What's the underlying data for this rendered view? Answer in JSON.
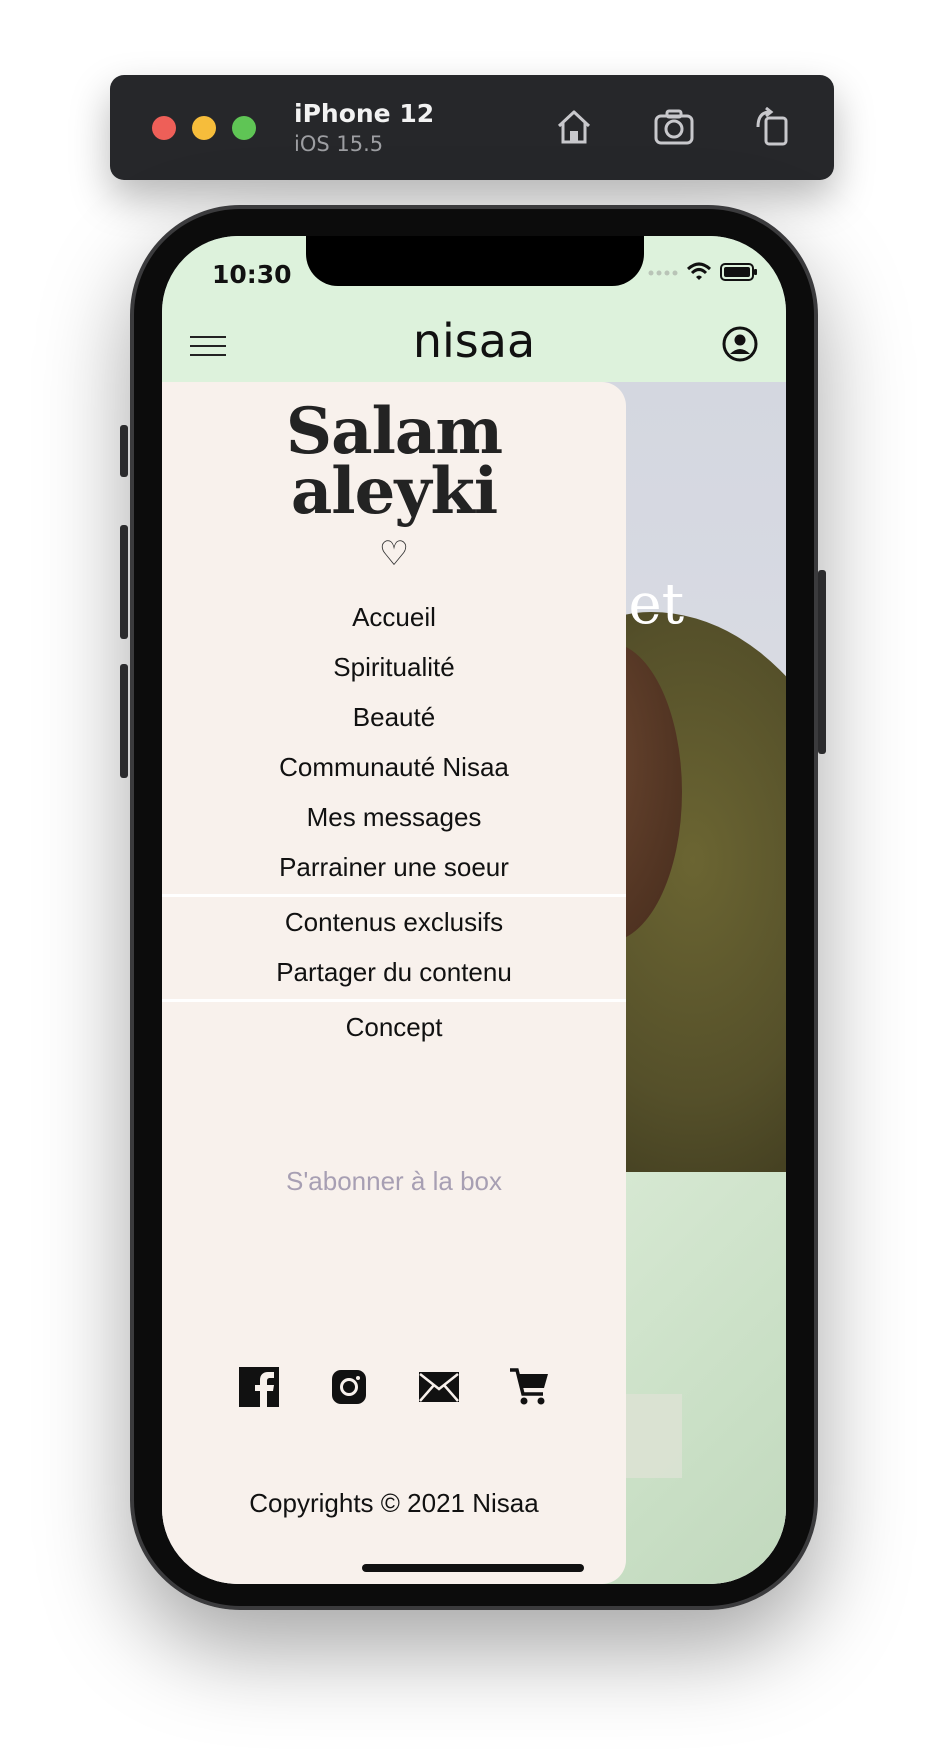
{
  "simulator": {
    "device_name": "iPhone 12",
    "os_version": "iOS 15.5",
    "icons": [
      "home-icon",
      "screenshot-icon",
      "rotate-icon"
    ]
  },
  "status_bar": {
    "time": "10:30",
    "icons": [
      "signal-icon",
      "wifi-icon",
      "battery-icon"
    ]
  },
  "header": {
    "brand": "nisaa",
    "menu_icon": "hamburger-icon",
    "account_icon": "account-icon",
    "background_color": "#ddf2dc"
  },
  "hero": {
    "visible_text": "s et"
  },
  "drawer": {
    "greeting_line1": "Salam",
    "greeting_line2": "aleyki",
    "heart": "♡",
    "menu_group1": [
      {
        "label": "Accueil"
      },
      {
        "label": "Spiritualité"
      },
      {
        "label": "Beauté"
      },
      {
        "label": "Communauté Nisaa"
      },
      {
        "label": "Mes messages"
      },
      {
        "label": "Parrainer une soeur"
      }
    ],
    "menu_group2": [
      {
        "label": "Contenus exclusifs"
      },
      {
        "label": "Partager du contenu"
      }
    ],
    "menu_group3": [
      {
        "label": "Concept"
      }
    ],
    "subscribe_label": "S'abonner à la box",
    "subscribe_color": "#a79fb3",
    "social_icons": [
      "facebook-icon",
      "instagram-icon",
      "mail-icon",
      "cart-icon"
    ],
    "copyright": "Copyrights © 2021 Nisaa",
    "background_color": "#f8f1ec"
  }
}
